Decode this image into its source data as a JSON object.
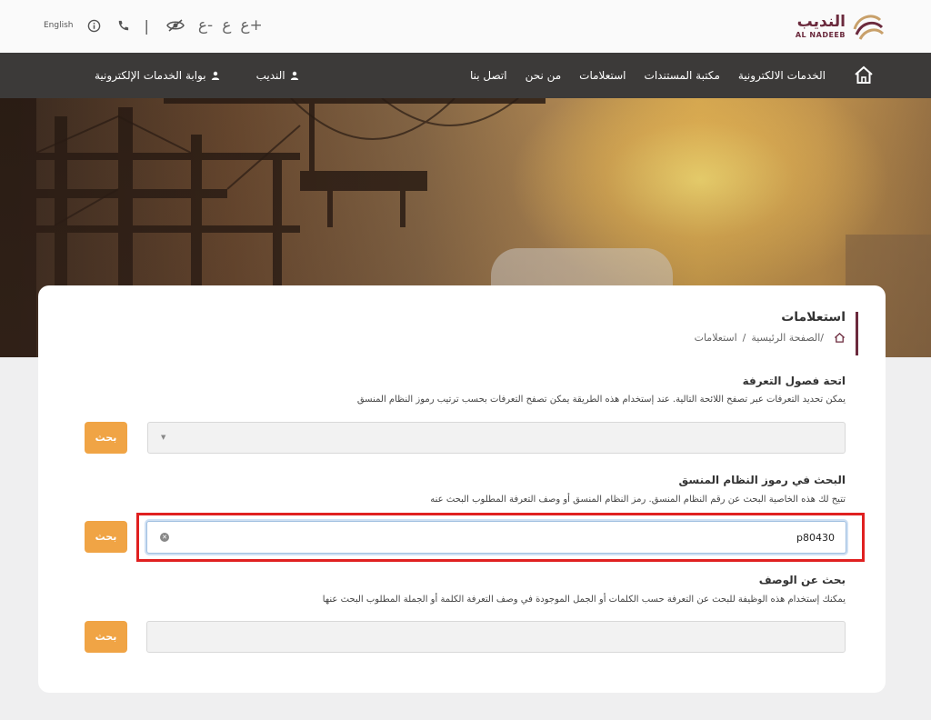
{
  "header": {
    "logo_ar": "النديب",
    "logo_en": "AL NADEEB",
    "language_link": "English",
    "font_increase": "ع+",
    "font_normal": "ع",
    "font_decrease": "ع-",
    "separator": "|"
  },
  "nav": {
    "items": [
      {
        "label": "الخدمات الالكترونية"
      },
      {
        "label": "مكتبة المستندات"
      },
      {
        "label": "استعلامات"
      },
      {
        "label": "من نحن"
      },
      {
        "label": "اتصل بنا"
      }
    ],
    "user_name": "النديب",
    "eportal": "بوابة الخدمات الإلكترونية"
  },
  "page": {
    "title": "استعلامات",
    "breadcrumb_home": "الصفحة الرئيسية",
    "breadcrumb_sep": "/",
    "breadcrumb_current": "استعلامات"
  },
  "sections": {
    "chapters": {
      "heading": "اتحة فصول التعرفة",
      "description": "يمكن تحديد التعرفات عبر تصفح اللائحة التالية. عند إستخدام هذه الطريقة يمكن تصفح التعرفات بحسب ترتيب رموز النظام المنسق",
      "select_value": "",
      "button": "بحث"
    },
    "hs_code": {
      "heading": "البحث في رموز النظام المنسق",
      "description": "تتيح لك هذه الخاصية البحث عن رقم النظام المنسق. رمز النظام المنسق أو وصف التعرفة المطلوب البحث عنه",
      "input_value": "p80430",
      "button": "بحث"
    },
    "description_search": {
      "heading": "بحث عن الوصف",
      "description": "يمكنك إستخدام هذه الوظيفة للبحث عن التعرفة حسب الكلمات أو الجمل الموجودة في وصف التعرفة الكلمة أو الجملة المطلوب البحث عنها",
      "input_value": "",
      "button": "بحث"
    }
  },
  "colors": {
    "brand": "#6b2a3d",
    "accent": "#f0a445",
    "nav_bg": "#3c3a39",
    "highlight": "#e02020"
  }
}
